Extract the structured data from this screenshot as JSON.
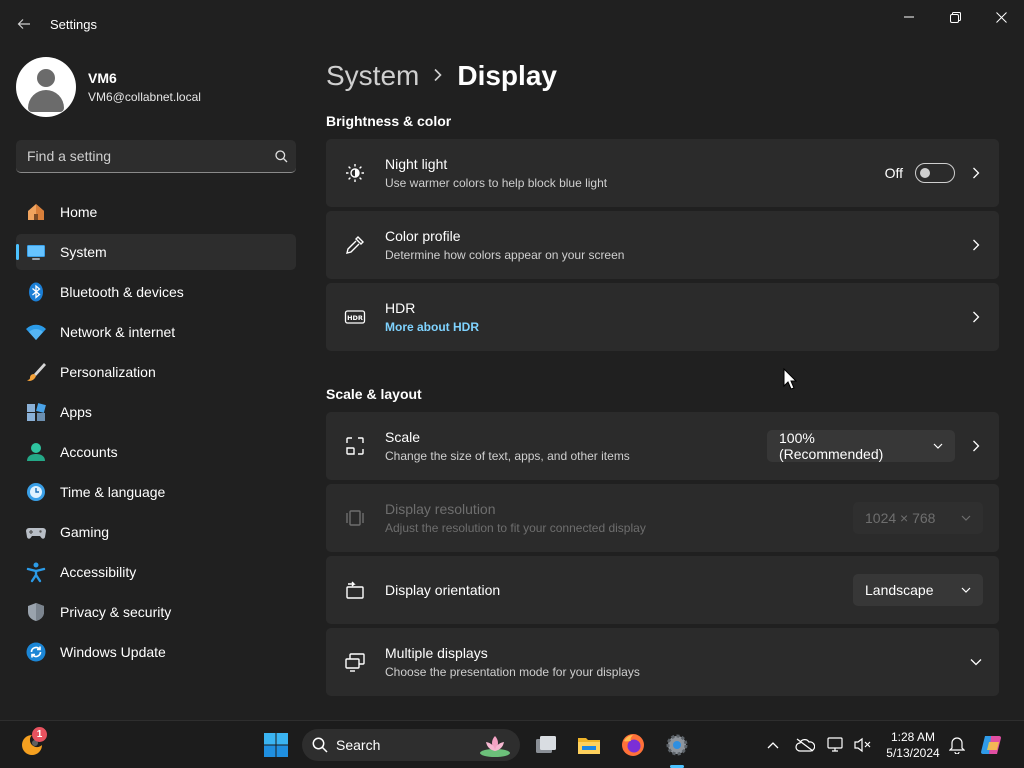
{
  "app": {
    "title": "Settings"
  },
  "profile": {
    "name": "VM6",
    "email": "VM6@collabnet.local"
  },
  "search": {
    "placeholder": "Find a setting"
  },
  "nav": [
    {
      "label": "Home",
      "icon": "home-icon"
    },
    {
      "label": "System",
      "icon": "system-icon",
      "active": true
    },
    {
      "label": "Bluetooth & devices",
      "icon": "bluetooth-icon"
    },
    {
      "label": "Network & internet",
      "icon": "wifi-icon"
    },
    {
      "label": "Personalization",
      "icon": "brush-icon"
    },
    {
      "label": "Apps",
      "icon": "apps-icon"
    },
    {
      "label": "Accounts",
      "icon": "accounts-icon"
    },
    {
      "label": "Time & language",
      "icon": "globe-clock-icon"
    },
    {
      "label": "Gaming",
      "icon": "gamepad-icon"
    },
    {
      "label": "Accessibility",
      "icon": "accessibility-icon"
    },
    {
      "label": "Privacy & security",
      "icon": "shield-icon"
    },
    {
      "label": "Windows Update",
      "icon": "update-icon"
    }
  ],
  "breadcrumb": {
    "parent": "System",
    "current": "Display"
  },
  "sections": {
    "brightness": "Brightness & color",
    "scale_layout": "Scale & layout"
  },
  "cards": {
    "night_light": {
      "title": "Night light",
      "subtitle": "Use warmer colors to help block blue light",
      "state": "Off"
    },
    "color_profile": {
      "title": "Color profile",
      "subtitle": "Determine how colors appear on your screen"
    },
    "hdr": {
      "title": "HDR",
      "link": "More about HDR"
    },
    "scale": {
      "title": "Scale",
      "subtitle": "Change the size of text, apps, and other items",
      "value": "100% (Recommended)"
    },
    "resolution": {
      "title": "Display resolution",
      "subtitle": "Adjust the resolution to fit your connected display",
      "value": "1024 × 768"
    },
    "orientation": {
      "title": "Display orientation",
      "value": "Landscape"
    },
    "multiple": {
      "title": "Multiple displays",
      "subtitle": "Choose the presentation mode for your displays"
    }
  },
  "taskbar": {
    "search_label": "Search",
    "time": "1:28 AM",
    "date": "5/13/2024",
    "notification_count": "1"
  },
  "colors": {
    "accent": "#4cc2ff",
    "link": "#7fd3ff",
    "background": "#202020",
    "card": "#2b2b2b"
  }
}
